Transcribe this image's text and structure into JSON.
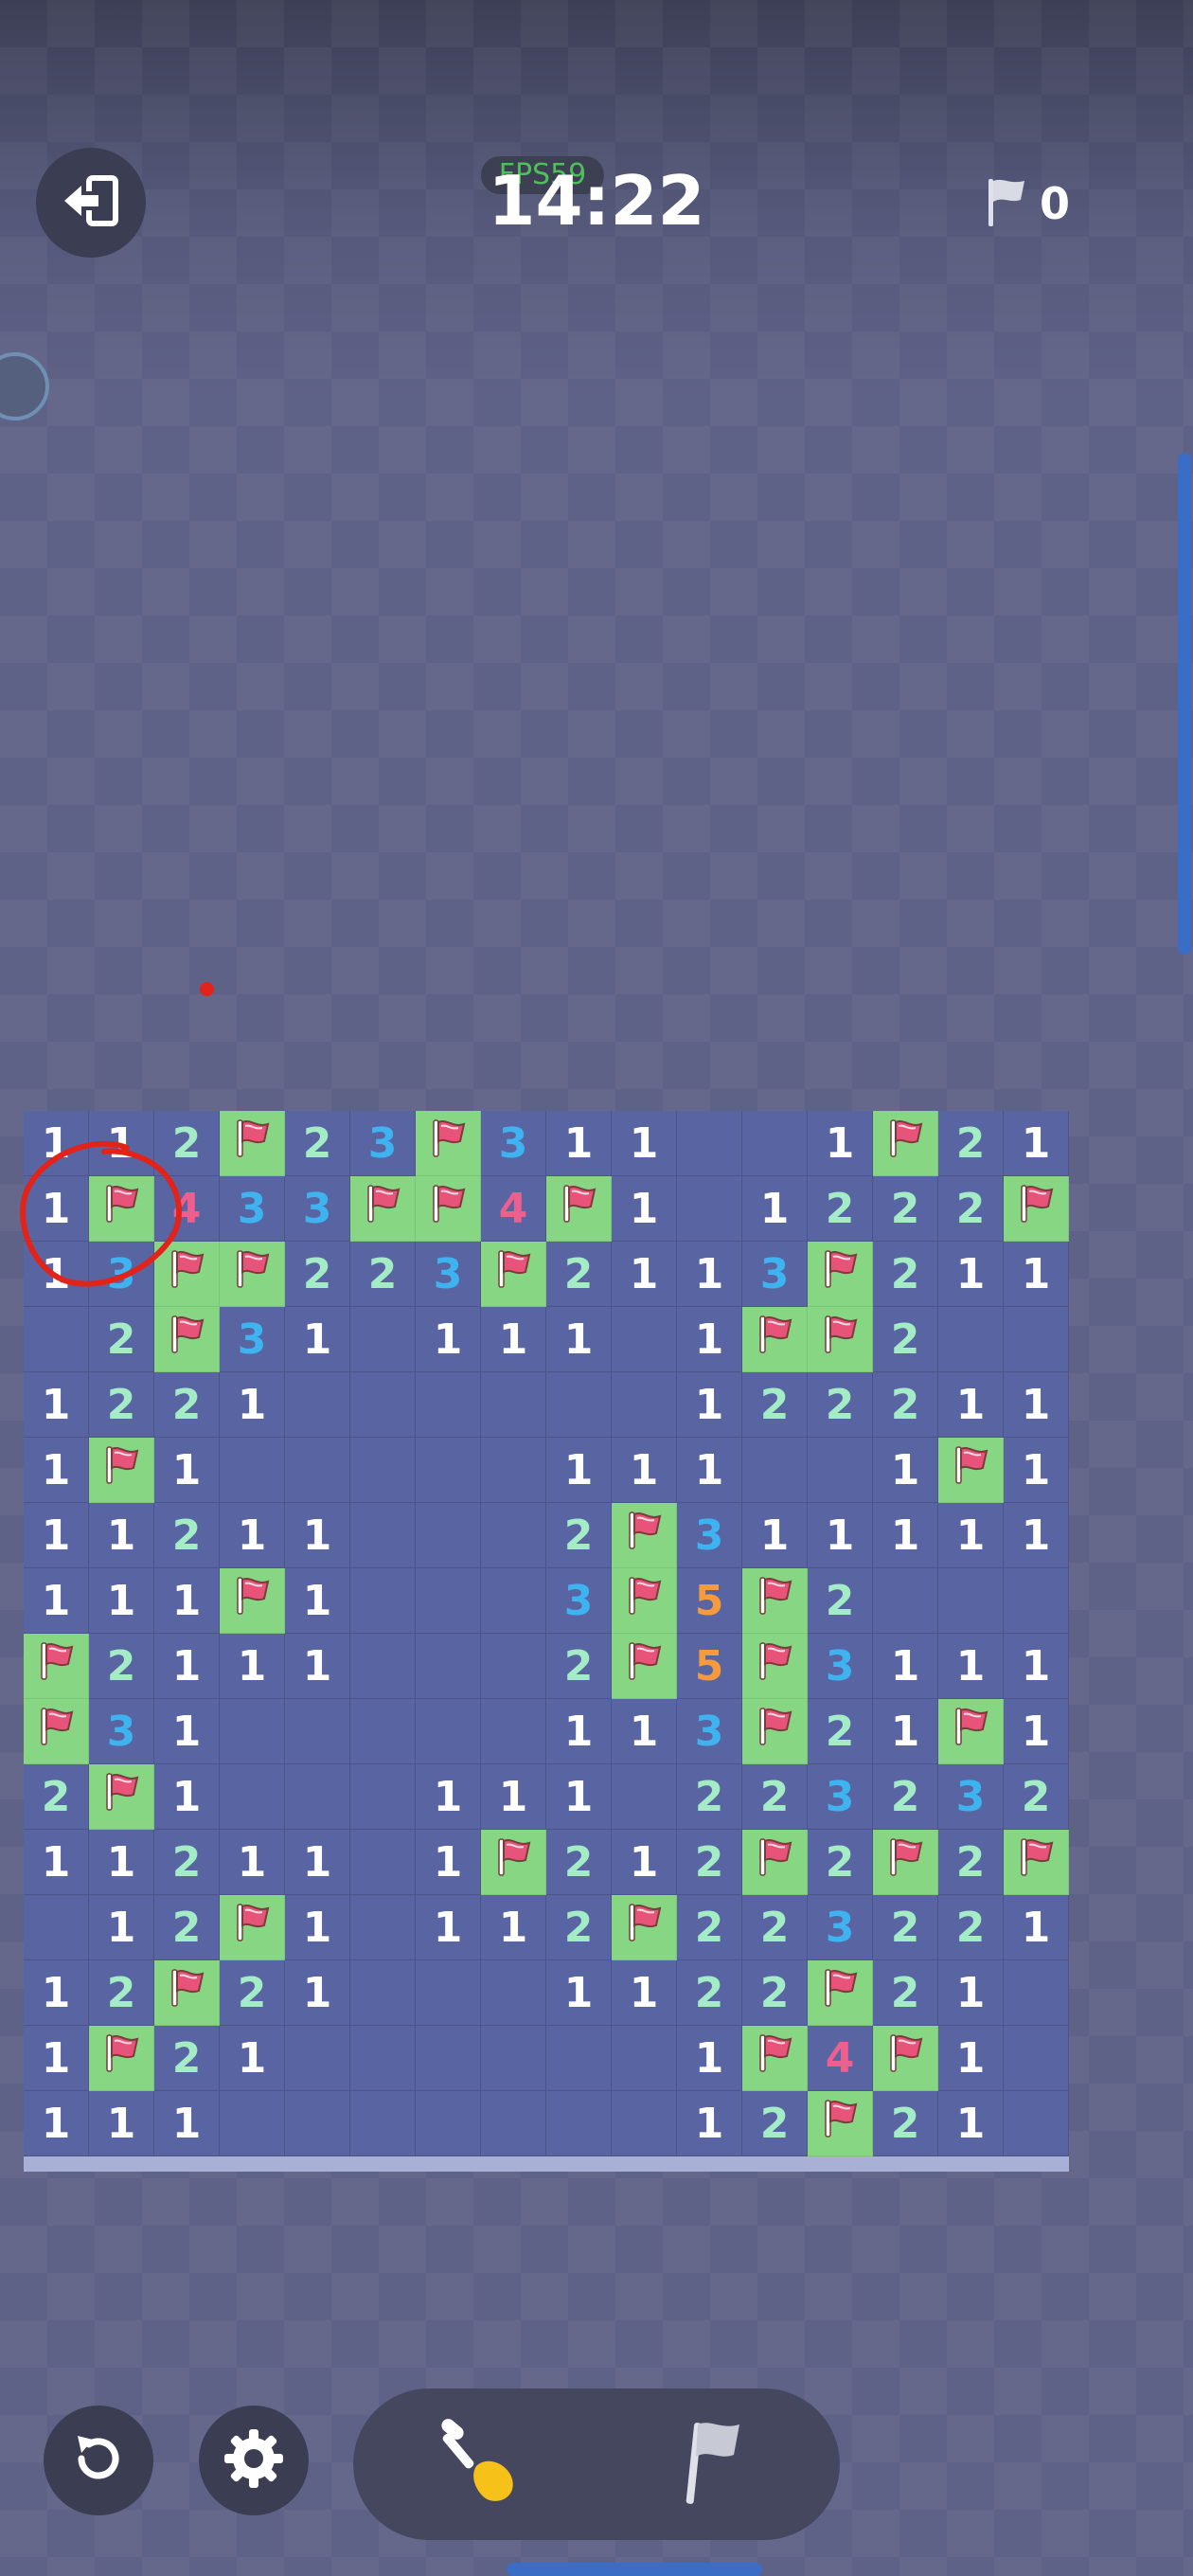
{
  "header": {
    "fps_label": "FPS59",
    "timer": "14:22",
    "flags_placed": "0",
    "exit_icon": "exit-icon",
    "flag_icon": "flag-icon"
  },
  "controls": {
    "restart_icon": "restart-icon",
    "settings_icon": "gear-icon",
    "dig_tool_icon": "shovel-icon",
    "flag_tool_icon": "flag-icon"
  },
  "colors": {
    "unrevealed": "#5865a2",
    "flagged": "#86d683",
    "number_1": "#ffffff",
    "number_2": "#a3ecc6",
    "number_3": "#3fb3f0",
    "number_4": "#ec5f8e",
    "number_5": "#f59b3d",
    "annotation": "#e2231a"
  },
  "board": {
    "columns": 16,
    "rows": [
      [
        "1",
        "1",
        "2",
        "F",
        "2",
        "3",
        "F",
        "3",
        "1",
        "1",
        "",
        "",
        "1",
        "F",
        "2",
        "1"
      ],
      [
        "1",
        "F",
        "4",
        "3",
        "3",
        "F",
        "F",
        "4",
        "F",
        "1",
        "",
        "1",
        "2",
        "2",
        "2",
        "F"
      ],
      [
        "1",
        "3",
        "F",
        "F",
        "2",
        "2",
        "3",
        "F",
        "2",
        "1",
        "1",
        "3",
        "F",
        "2",
        "1",
        "1"
      ],
      [
        "",
        "2",
        "F",
        "3",
        "1",
        "",
        "1",
        "1",
        "1",
        "",
        "1",
        "F",
        "F",
        "2",
        "",
        ""
      ],
      [
        "1",
        "2",
        "2",
        "1",
        "",
        "",
        "",
        "",
        "",
        "",
        "1",
        "2",
        "2",
        "2",
        "1",
        "1"
      ],
      [
        "1",
        "F",
        "1",
        "",
        "",
        "",
        "",
        "",
        "1",
        "1",
        "1",
        "",
        "",
        "1",
        "F",
        "1"
      ],
      [
        "1",
        "1",
        "2",
        "1",
        "1",
        "",
        "",
        "",
        "2",
        "F",
        "3",
        "1",
        "1",
        "1",
        "1",
        "1"
      ],
      [
        "1",
        "1",
        "1",
        "F",
        "1",
        "",
        "",
        "",
        "3",
        "F",
        "5",
        "F",
        "2",
        "",
        "",
        ""
      ],
      [
        "F",
        "2",
        "1",
        "1",
        "1",
        "",
        "",
        "",
        "2",
        "F",
        "5",
        "F",
        "3",
        "1",
        "1",
        "1"
      ],
      [
        "F",
        "3",
        "1",
        "",
        "",
        "",
        "",
        "",
        "1",
        "1",
        "3",
        "F",
        "2",
        "1",
        "F",
        "1"
      ],
      [
        "2",
        "F",
        "1",
        "",
        "",
        "",
        "1",
        "1",
        "1",
        "",
        "2",
        "2",
        "3",
        "2",
        "3",
        "2"
      ],
      [
        "1",
        "1",
        "2",
        "1",
        "1",
        "",
        "1",
        "F",
        "2",
        "1",
        "2",
        "F",
        "2",
        "F",
        "2",
        "F"
      ],
      [
        "",
        "1",
        "2",
        "F",
        "1",
        "",
        "1",
        "1",
        "2",
        "F",
        "2",
        "2",
        "3",
        "2",
        "2",
        "1"
      ],
      [
        "1",
        "2",
        "F",
        "2",
        "1",
        "",
        "",
        "",
        "1",
        "1",
        "2",
        "2",
        "F",
        "2",
        "1",
        ""
      ],
      [
        "1",
        "F",
        "2",
        "1",
        "",
        "",
        "",
        "",
        "",
        "",
        "1",
        "F",
        "4",
        "F",
        "1",
        ""
      ],
      [
        "1",
        "1",
        "1",
        "",
        "",
        "",
        "",
        "",
        "",
        "",
        "1",
        "2",
        "F",
        "2",
        "1",
        ""
      ]
    ]
  }
}
